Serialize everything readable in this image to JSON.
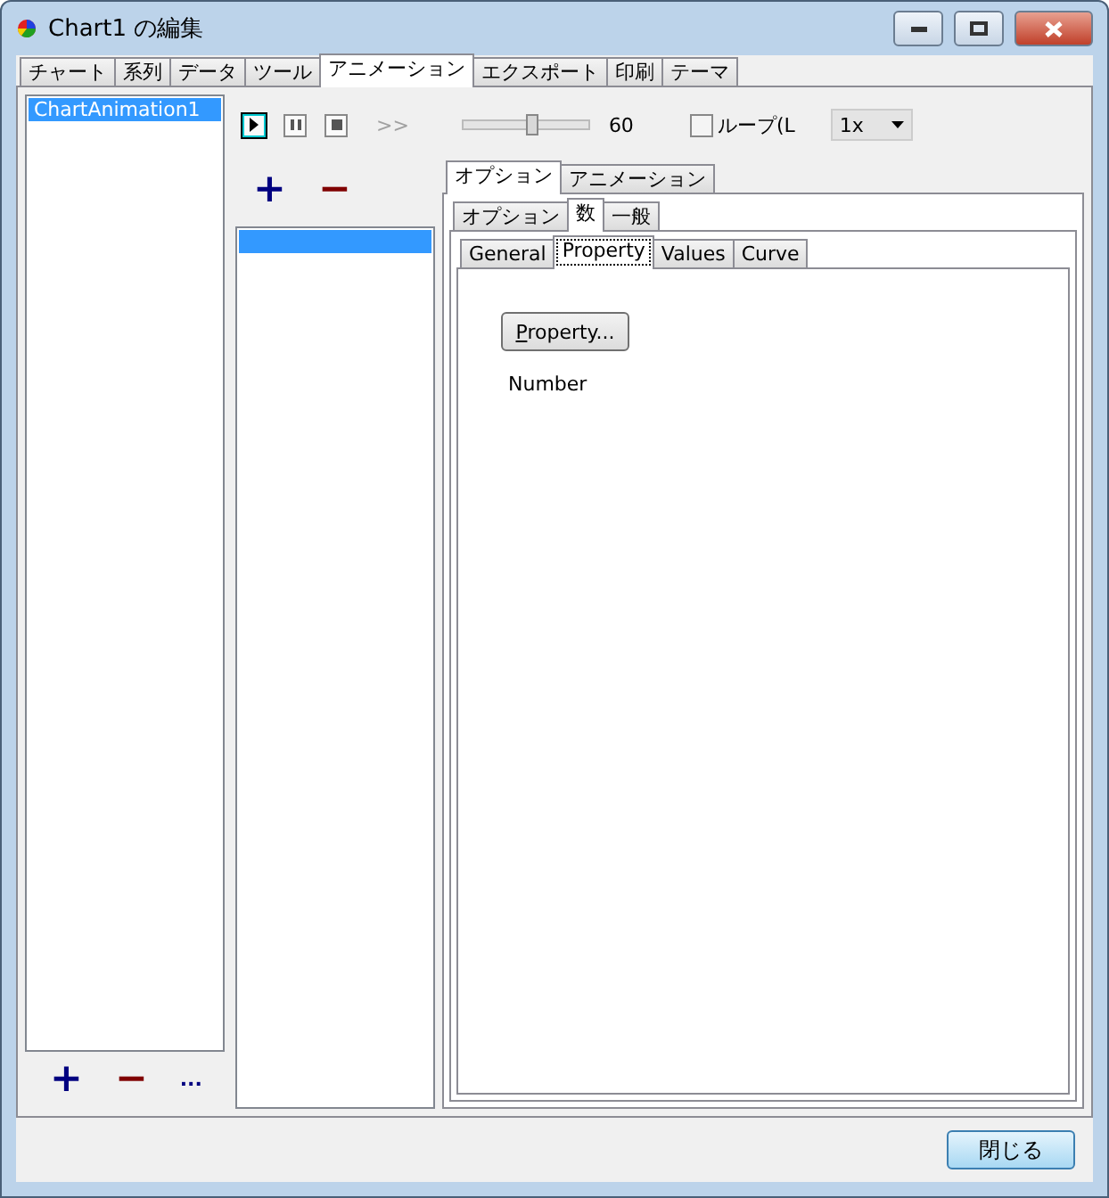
{
  "window": {
    "title": "Chart1 の編集"
  },
  "tabs": [
    {
      "label": "チャート",
      "selected": false
    },
    {
      "label": "系列",
      "selected": false
    },
    {
      "label": "データ",
      "selected": false
    },
    {
      "label": "ツール",
      "selected": false
    },
    {
      "label": "アニメーション",
      "selected": true
    },
    {
      "label": "エクスポート",
      "selected": false
    },
    {
      "label": "印刷",
      "selected": false
    },
    {
      "label": "テーマ",
      "selected": false
    }
  ],
  "animations": {
    "items": [
      {
        "label": "ChartAnimation1",
        "selected": true
      }
    ],
    "buttons": [
      "+",
      "−",
      "..."
    ]
  },
  "toolbar": {
    "transport": [
      {
        "kind": "play",
        "selected": true
      },
      {
        "kind": "pause",
        "selected": false
      },
      {
        "kind": "stop",
        "selected": false
      }
    ],
    "fast_forward": {
      "label": ">>",
      "disabled": true
    },
    "speed": {
      "level": 0.53,
      "reading": "60"
    },
    "loop": {
      "label": "ループ(L",
      "checked": false
    },
    "zoom": {
      "value": "1x"
    }
  },
  "steps": {
    "buttons": [
      "+",
      "−"
    ],
    "items": [
      {
        "selected": true
      }
    ]
  },
  "tabs_outer": [
    {
      "label": "オプション",
      "selected": true
    },
    {
      "label": "アニメーション",
      "selected": false
    }
  ],
  "tabs_middle": [
    {
      "label": "オプション",
      "selected": false
    },
    {
      "label": "数",
      "selected": true
    },
    {
      "label": "一般",
      "selected": false
    }
  ],
  "tabs_inner": [
    {
      "label": "General",
      "selected": false
    },
    {
      "label": "Property",
      "selected": true
    },
    {
      "label": "Values",
      "selected": false
    },
    {
      "label": "Curve",
      "selected": false
    }
  ],
  "property_button": {
    "label": "Property..."
  },
  "property_name": "Number",
  "close_button": "閉じる"
}
